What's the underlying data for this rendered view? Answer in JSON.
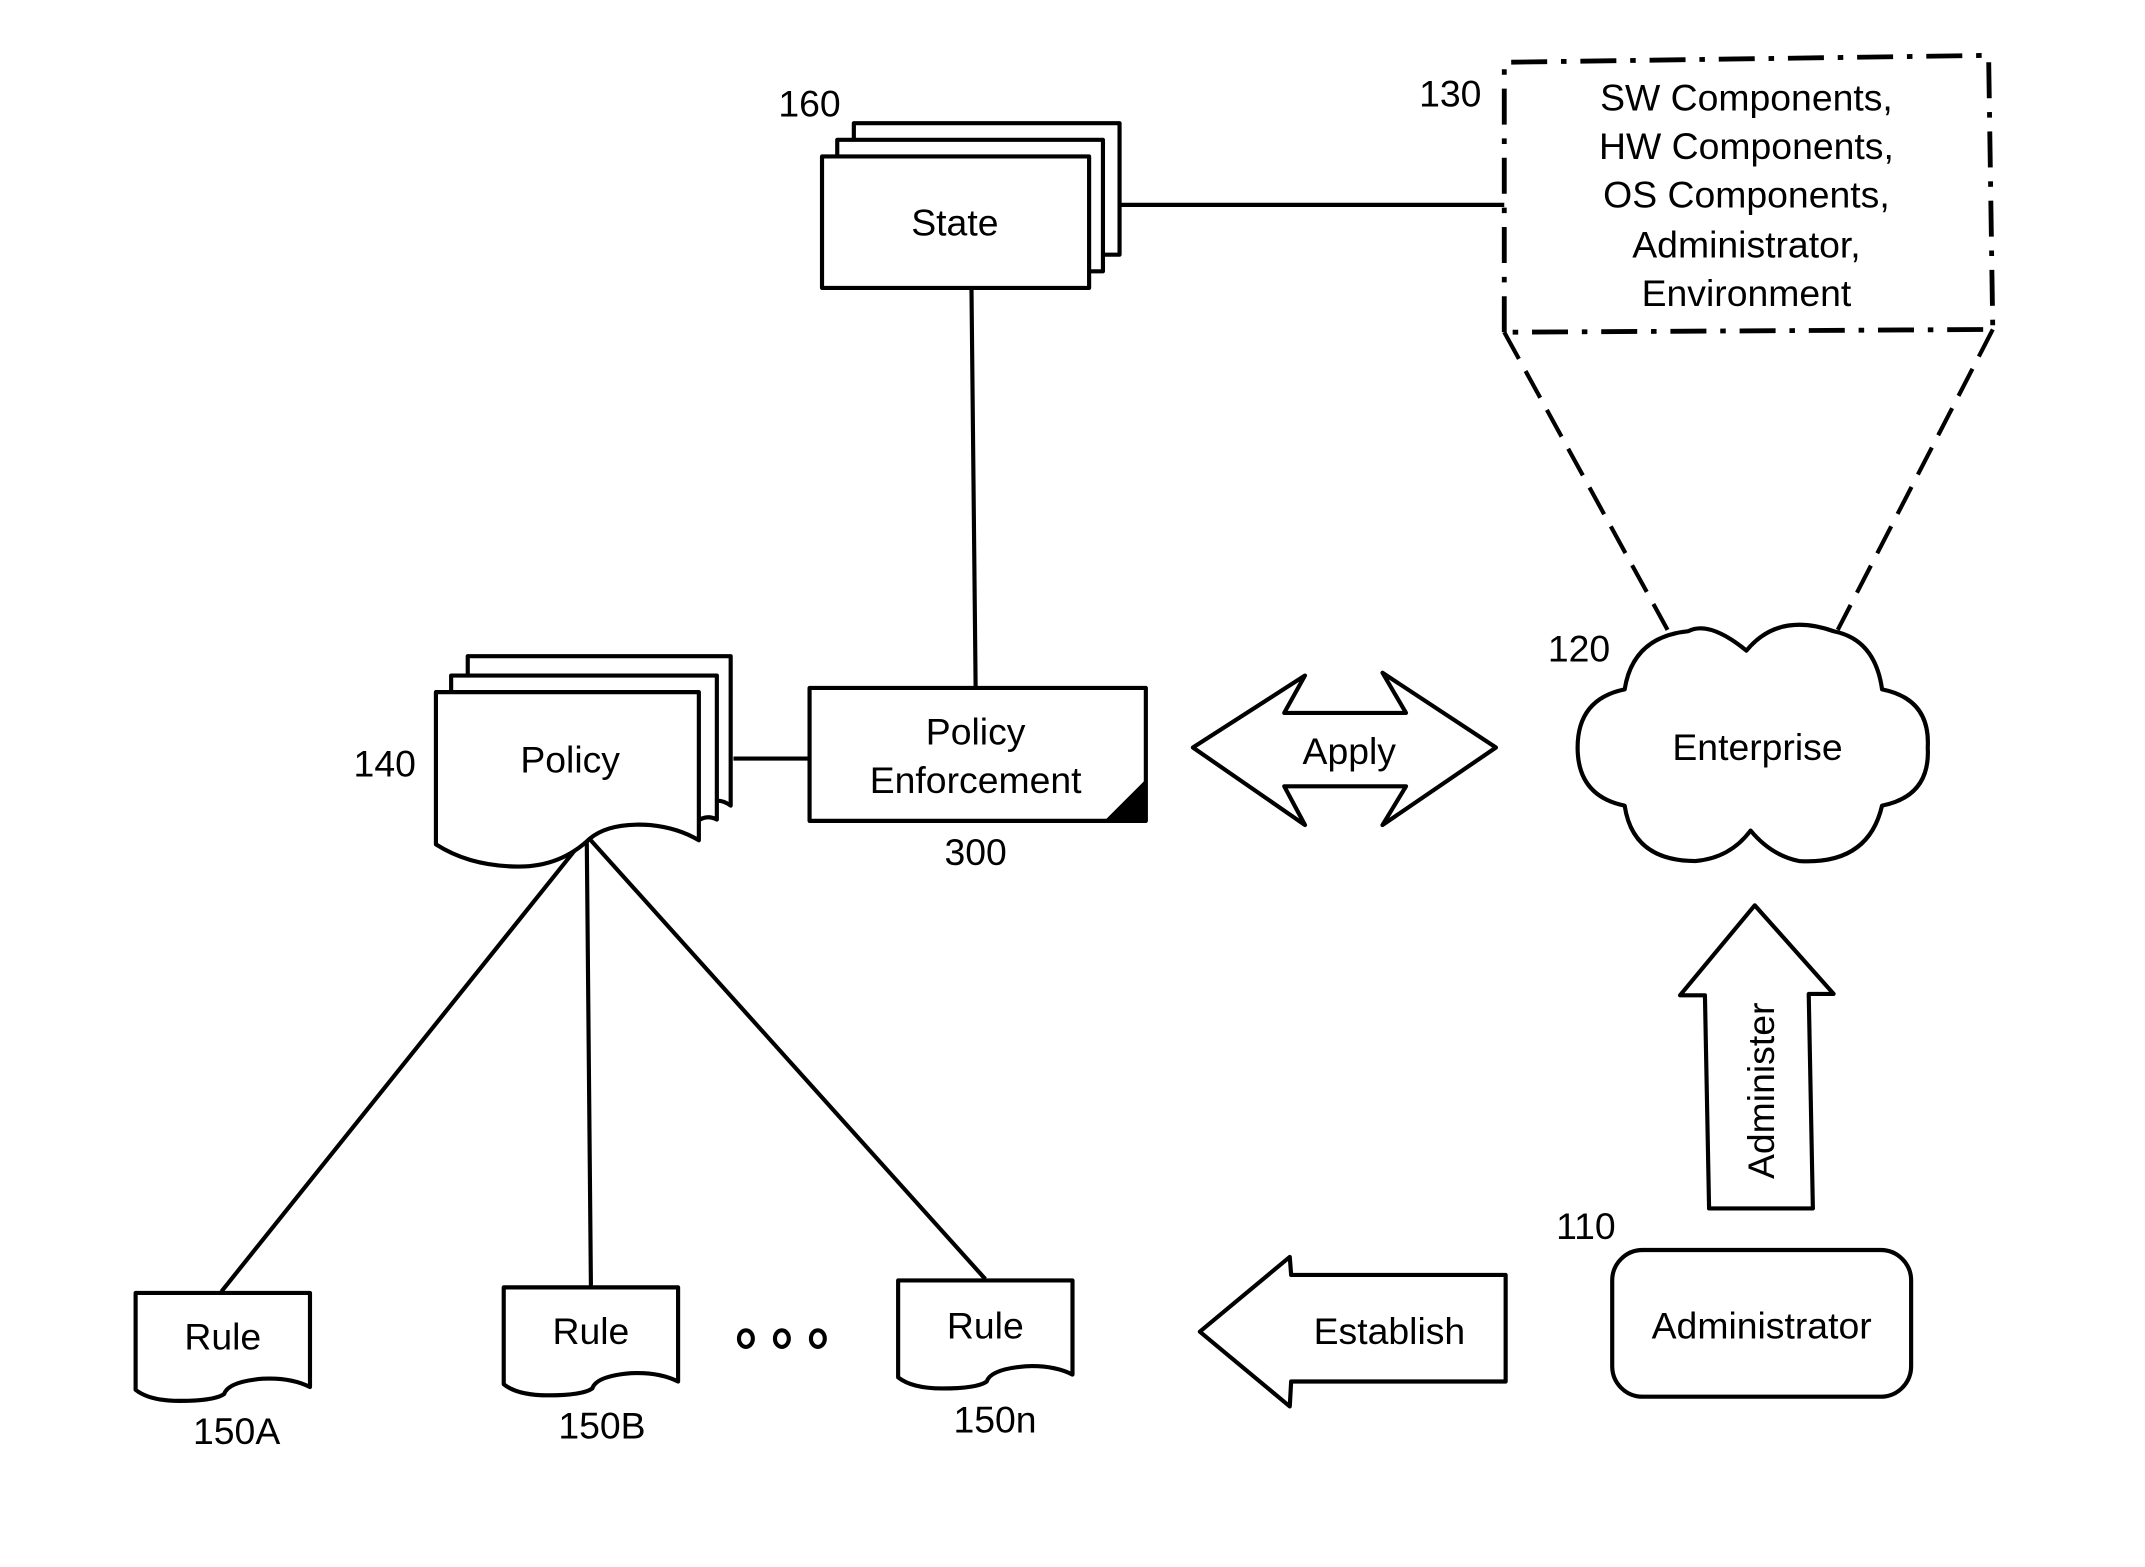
{
  "diagram": {
    "nodes": {
      "state": {
        "ref": "160",
        "label": "State"
      },
      "components": {
        "ref": "130",
        "lines": [
          "SW Components,",
          "HW Components,",
          "OS Components,",
          "Administrator,",
          "Environment"
        ]
      },
      "policy": {
        "ref": "140",
        "label": "Policy"
      },
      "enforcement": {
        "ref": "300",
        "line1": "Policy",
        "line2": "Enforcement"
      },
      "enterprise": {
        "ref": "120",
        "label": "Enterprise"
      },
      "administrator": {
        "ref": "110",
        "label": "Administrator"
      },
      "rules": [
        {
          "ref": "150A",
          "label": "Rule"
        },
        {
          "ref": "150B",
          "label": "Rule"
        },
        {
          "ref": "150n",
          "label": "Rule"
        }
      ],
      "ellipsis": "ooo"
    },
    "arrows": {
      "apply": {
        "label": "Apply",
        "direction": "bidirectional"
      },
      "administer": {
        "label": "Administer",
        "direction": "up"
      },
      "establish": {
        "label": "Establish",
        "direction": "left"
      }
    },
    "colors": {
      "stroke": "#000000",
      "background": "#ffffff",
      "fill": "#ffffff"
    }
  }
}
